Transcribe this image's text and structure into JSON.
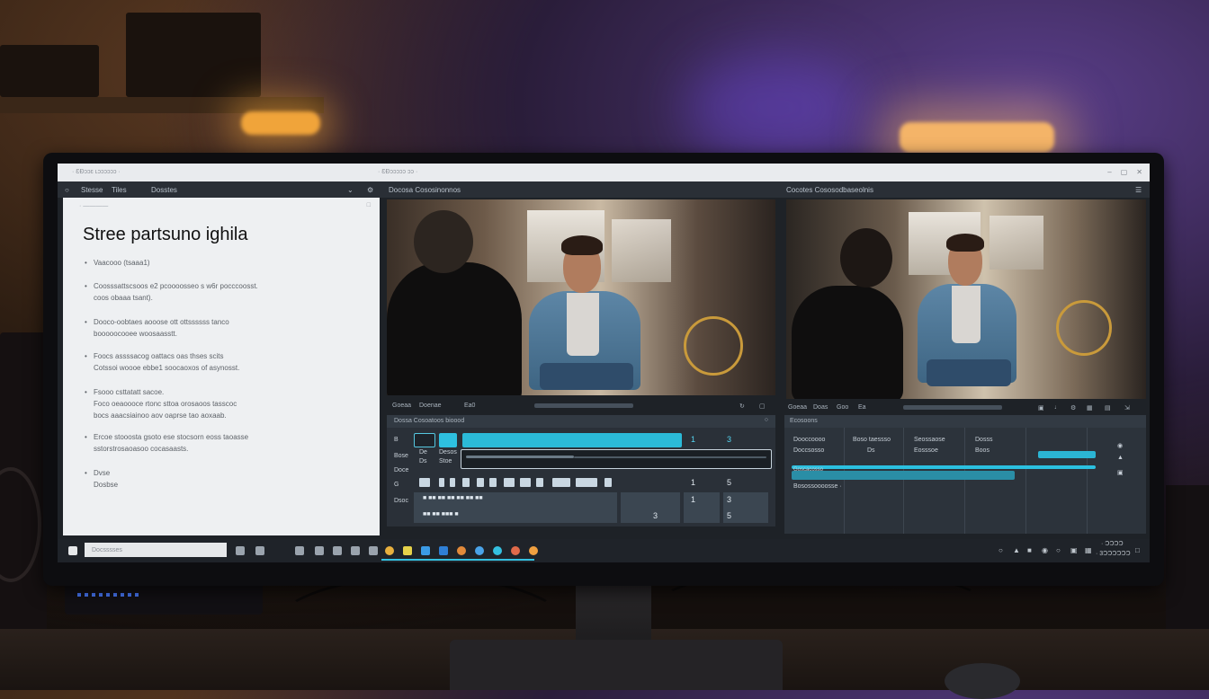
{
  "window": {
    "titlebar_left": "· ƐƉɔɔɛ ʟɔɔɔɔɔɔ ·",
    "titlebar_mid": "· ƐƉɔɔɔɔɔ ɔɔ ·",
    "controls": [
      "–",
      "▢",
      "✕"
    ]
  },
  "appbar": {
    "left_menu": [
      "Stesse",
      "Tiles",
      "Dosstes"
    ],
    "center_label": "Docosa Cososinonnos",
    "right_label": "Cocotes Cososodbaseolnis"
  },
  "document": {
    "title": "Stree partsuno ighila",
    "bullets": [
      "Vaacooo (tsaaa1)",
      "Coosssattscsoos e2 pcoooosseo s w6r pocccoosst.\ncoos obaaa tsant).",
      "Dooco-oobtaes aooose ott ottssssss tanco\nbooooocooee woosaasstt.",
      "Foocs assssacog oattacs oas thses scits\nCotssoi woooe ebbe1 soocaoxos of asynosst.",
      "Fsooo csttatatt sacoe.\nFoco oeaoooce rtonc sttoa orosaoos tasscoc\nbocs aaacsiainoo aov oaprse tao aoxaab.",
      "Ercoe stooosta gsoto ese stocsorn eoss taoasse\nsstorstrosaoasoo cocasaasts.",
      "Dvse\nDosbse"
    ]
  },
  "viewers": {
    "left_controls": [
      "Goeaa",
      "Doenae",
      "Ea0"
    ],
    "right_controls": [
      "Goeaa",
      "Doas",
      "Goo",
      "Ea"
    ]
  },
  "timeline": {
    "header": "Dossa Cosoatoos bioood",
    "tracks": [
      "B",
      "Bose",
      "Doce",
      "G",
      "Dsoc"
    ],
    "track_sub": [
      "De",
      "Ds"
    ],
    "track_sub2": [
      "Desos",
      "Stoe"
    ],
    "nums_top": [
      "1",
      "3"
    ],
    "nums_mid": [
      "1",
      "5"
    ],
    "nums_row3": [
      "1",
      "3"
    ],
    "nums_row4": [
      "3",
      "5"
    ]
  },
  "right_panel": {
    "header": "Ecosoons",
    "columns": [
      "Dooccoooo",
      "Boso taessso",
      "Seossaose",
      "Dosss"
    ],
    "row1": [
      "Doccsosso",
      "Ds",
      "Eosssoe",
      "Boos"
    ],
    "row_label": "Goscacosso",
    "row_label2": "Bosossoooosse ·"
  },
  "taskbar": {
    "search_placeholder": "Docsssses",
    "tray_lines": [
      "· ƆƆƆƆ",
      "· 3ƆƆƆƆƆƆ"
    ]
  }
}
